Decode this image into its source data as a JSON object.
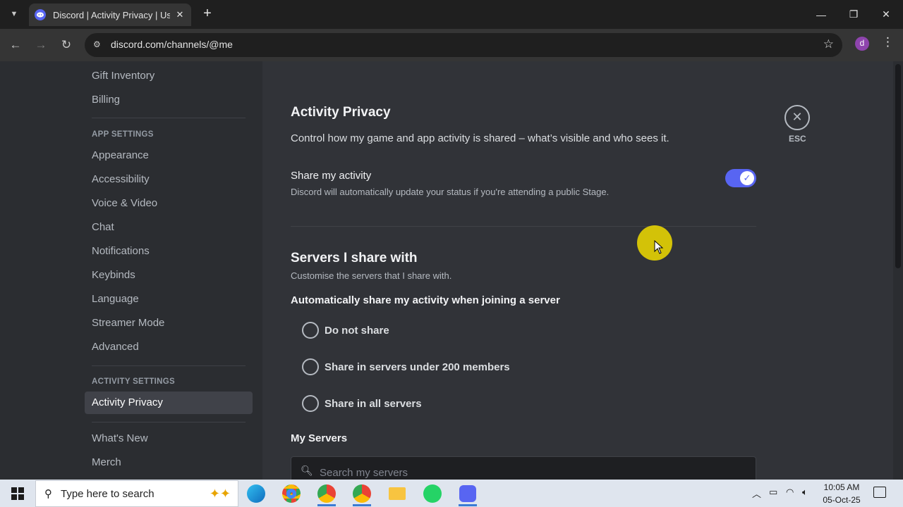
{
  "browser": {
    "tab_title": "Discord | Activity Privacy | User",
    "url": "discord.com/channels/@me",
    "profile_initial": "d"
  },
  "sidebar": {
    "items_top": [
      "Gift Inventory",
      "Billing"
    ],
    "app_settings_header": "APP SETTINGS",
    "app_settings": [
      "Appearance",
      "Accessibility",
      "Voice & Video",
      "Chat",
      "Notifications",
      "Keybinds",
      "Language",
      "Streamer Mode",
      "Advanced"
    ],
    "activity_settings_header": "ACTIVITY SETTINGS",
    "activity_settings": [
      "Activity Privacy"
    ],
    "items_bottom": [
      "What's New",
      "Merch"
    ]
  },
  "main": {
    "title": "Activity Privacy",
    "description": "Control how my game and app activity is shared – what’s visible and who sees it.",
    "esc_label": "ESC",
    "share_activity": {
      "title": "Share my activity",
      "note": "Discord will automatically update your status if you're attending a public Stage.",
      "enabled": true
    },
    "servers_title": "Servers I share with",
    "servers_note": "Customise the servers that I share with.",
    "auto_share_label": "Automatically share my activity when joining a server",
    "radio_options": [
      "Do not share",
      "Share in servers under 200 members",
      "Share in all servers"
    ],
    "my_servers_label": "My Servers",
    "search_placeholder": "Search my servers"
  },
  "taskbar": {
    "search_placeholder": "Type here to search",
    "time": "10:05 AM",
    "date": "05-Oct-25"
  },
  "colors": {
    "accent": "#5865f2",
    "sidebar_bg": "#2b2d31",
    "content_bg": "#313338",
    "cursor_highlight": "#f0dc00"
  }
}
